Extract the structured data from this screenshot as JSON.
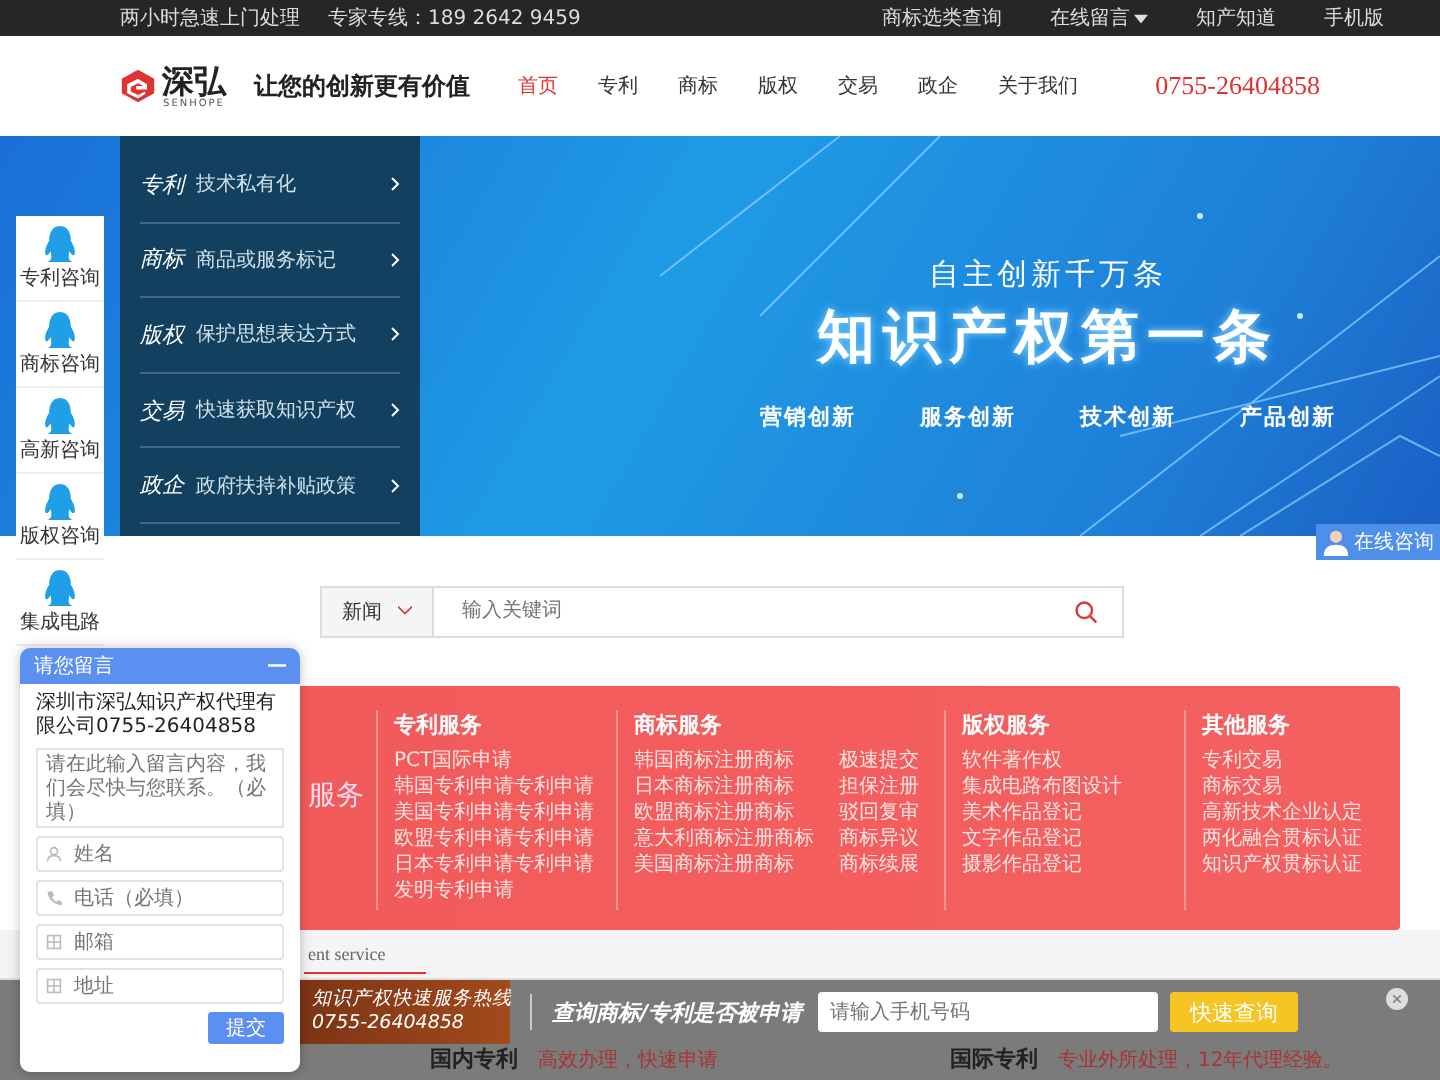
{
  "top_bar": {
    "left": [
      "两小时急速上门处理",
      "专家专线：189 2642 9459"
    ],
    "right": [
      {
        "label": "商标选类查询",
        "has_menu": false
      },
      {
        "label": "在线留言",
        "has_menu": true
      },
      {
        "label": "知产知道",
        "has_menu": false
      },
      {
        "label": "手机版",
        "has_menu": false
      }
    ]
  },
  "header": {
    "logo_name": "深弘",
    "logo_sub": "SENHOPE",
    "slogan": "让您的创新更有价值",
    "nav": [
      {
        "label": "首页",
        "selected": true
      },
      {
        "label": "专利",
        "selected": false
      },
      {
        "label": "商标",
        "selected": false
      },
      {
        "label": "版权",
        "selected": false
      },
      {
        "label": "交易",
        "selected": false
      },
      {
        "label": "政企",
        "selected": false
      },
      {
        "label": "关于我们",
        "selected": false
      }
    ],
    "phone": "0755-26404858"
  },
  "hero": {
    "menu": [
      {
        "title": "专利",
        "desc": "技术私有化"
      },
      {
        "title": "商标",
        "desc": "商品或服务标记"
      },
      {
        "title": "版权",
        "desc": "保护思想表达方式"
      },
      {
        "title": "交易",
        "desc": "快速获取知识产权"
      },
      {
        "title": "政企",
        "desc": "政府扶持补贴政策"
      }
    ],
    "tagline": "自主创新千万条",
    "headline": "知识产权第一条",
    "features": [
      "营销创新",
      "服务创新",
      "技术创新",
      "产品创新"
    ]
  },
  "search": {
    "category": "新闻",
    "placeholder": "输入关键词"
  },
  "services": {
    "title_fragment": "服务",
    "columns": [
      {
        "title": "专利服务",
        "kind": "single",
        "items": [
          "PCT国际申请",
          "韩国专利申请专利申请",
          "美国专利申请专利申请",
          "欧盟专利申请专利申请",
          "日本专利申请专利申请",
          "发明专利申请"
        ]
      },
      {
        "title": "商标服务",
        "kind": "double",
        "items": [
          "韩国商标注册商标",
          "极速提交",
          "日本商标注册商标",
          "担保注册",
          "欧盟商标注册商标",
          "驳回复审",
          "意大利商标注册商标",
          "商标异议",
          "美国商标注册商标",
          "商标续展"
        ]
      },
      {
        "title": "版权服务",
        "kind": "single",
        "items": [
          "软件著作权",
          "集成电路布图设计",
          "美术作品登记",
          "文字作品登记",
          "摄影作品登记"
        ]
      },
      {
        "title": "其他服务",
        "kind": "single",
        "items": [
          "专利交易",
          "商标交易",
          "高新技术企业认定",
          "两化融合贯标认证",
          "知识产权贯标认证"
        ]
      }
    ]
  },
  "tab_strip": {
    "label": "ent service"
  },
  "qq_sidebar": [
    "专利咨询",
    "商标咨询",
    "高新咨询",
    "版权咨询",
    "集成电路"
  ],
  "online_consult": "在线咨询",
  "message_popup": {
    "title": "请您留言",
    "company": "深圳市深弘知识产权代理有限公司0755-26404858",
    "placeholder": "请在此输入留言内容，我们会尽快与您联系。（必填）",
    "fields": [
      {
        "kind": "person",
        "placeholder": "姓名"
      },
      {
        "kind": "phone",
        "placeholder": "电话（必填）"
      },
      {
        "kind": "mail",
        "placeholder": "邮箱"
      },
      {
        "kind": "address",
        "placeholder": "地址"
      }
    ],
    "submit": "提交"
  },
  "bottom_bar": {
    "hotline_label": "知识产权快速服务热线",
    "hotline_number": "0755-26404858",
    "query_label": "查询商标/专利是否被申请",
    "phone_placeholder": "请输入手机号码",
    "button": "快速查询",
    "promos": [
      {
        "title": "国内专利",
        "desc": "高效办理，快速申请"
      },
      {
        "title": "国际专利",
        "desc": "专业外所处理，12年代理经验。"
      }
    ]
  }
}
